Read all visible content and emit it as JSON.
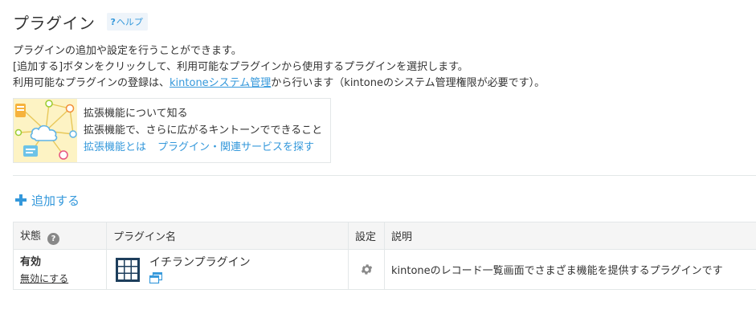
{
  "header": {
    "title": "プラグイン",
    "help_q": "?",
    "help_label": "ヘルプ"
  },
  "description": {
    "line1": "プラグインの追加や設定を行うことができます。",
    "line2": "[追加する]ボタンをクリックして、利用可能なプラグインから使用するプラグインを選択します。",
    "line3_prefix": "利用可能なプラグインの登録は、",
    "line3_link": "kintoneシステム管理",
    "line3_suffix": "から行います（kintoneのシステム管理権限が必要です）。"
  },
  "extension_card": {
    "title": "拡張機能について知る",
    "subtitle": "拡張機能で、さらに広がるキントーンでできること",
    "link1": "拡張機能とは",
    "link2": "プラグイン・関連サービスを探す"
  },
  "add_button": {
    "label": "追加する"
  },
  "table": {
    "headers": {
      "status": "状態",
      "status_help": "?",
      "name": "プラグイン名",
      "settings": "設定",
      "description": "説明"
    },
    "rows": [
      {
        "status": "有効",
        "disable_label": "無効にする",
        "name": "イチランプラグイン",
        "description": "kintoneのレコード一覧画面でさまざま機能を提供するプラグインです"
      }
    ]
  },
  "colors": {
    "link": "#3498db",
    "text": "#333333",
    "border": "#e3e7e8",
    "header_bg": "#f5f5f5",
    "plugin_icon": "#1d3e5c",
    "illustration_bg": "#fdf3c4"
  },
  "icons": {
    "help": "question-icon",
    "add": "plus-icon",
    "plugin": "grid-icon",
    "open": "window-icon",
    "settings": "gear-icon"
  }
}
